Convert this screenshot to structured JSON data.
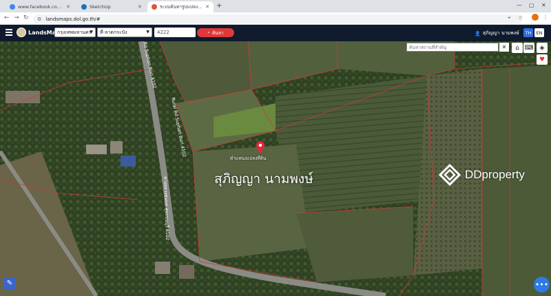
{
  "browser": {
    "tabs": [
      {
        "title": "www.facebook.com login - ค้นห",
        "active": false
      },
      {
        "title": "SketchUp",
        "active": false
      },
      {
        "title": "ระบบค้นหารูปแปลงที่ดิน (LandsMa",
        "active": true
      }
    ],
    "new_tab": "+",
    "url": "landsmaps.dol.go.th/#",
    "profile_color": "#e8710a"
  },
  "header": {
    "app_name": "LandsMaps",
    "province": "กรุงเทพมหานคร",
    "district": "ที่-ลาดกระบัง",
    "parcel_value": "4222",
    "search_label": "ค้นหา",
    "user_name": "สุภิญญา นามพงษ์",
    "lang_th": "TH",
    "lang_en": "EN",
    "accent": "#e03838"
  },
  "map": {
    "landmark_placeholder": "ค้นหาสถานที่สำคัญ",
    "clear": "✕",
    "pin_label": "ตำแหน่งแปลงที่ดิน",
    "owner_name": "สุภิญญา นามพงษ์",
    "watermark": "DDproperty",
    "roads": [
      "Rd Suphan Buri 4102",
      "Rural Rd Suphan Buri 4102",
      "ทางหลวงชนบท สุพรรณบุรี 4102"
    ],
    "icons": [
      "home-icon",
      "layers-icon",
      "keyboard-icon",
      "heart-icon",
      "tool-icon",
      "chat-icon"
    ]
  }
}
